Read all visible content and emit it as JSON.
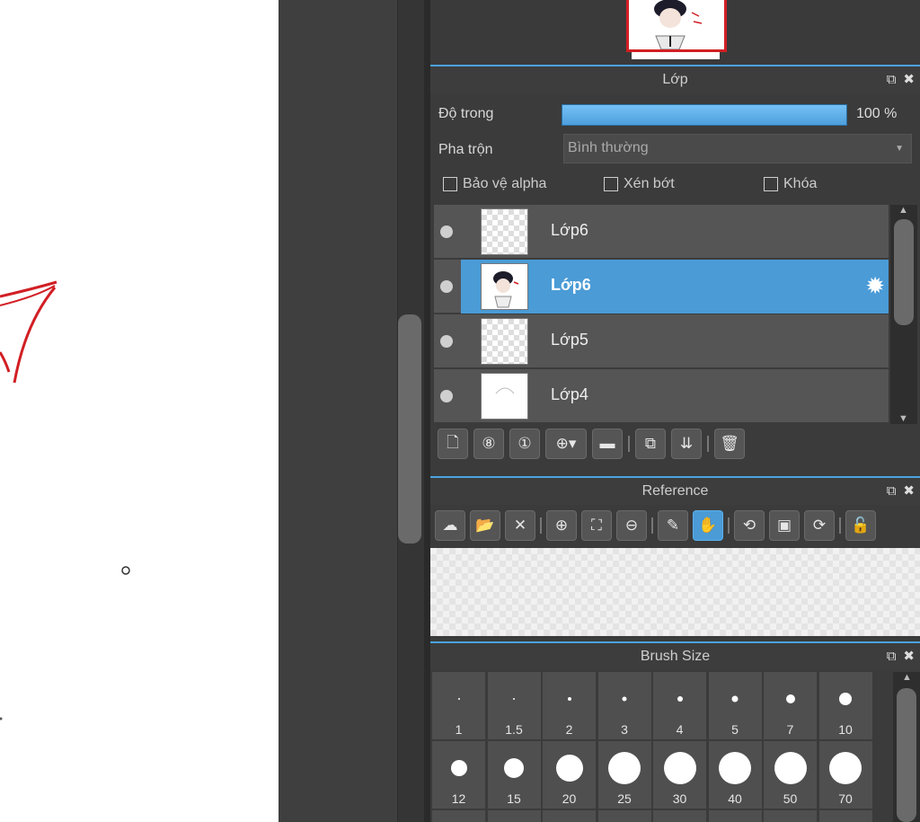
{
  "layer_panel": {
    "title": "Lớp",
    "opacity_label": "Độ trong",
    "opacity_value": "100 %",
    "opacity_fraction": 1.0,
    "blend_label": "Pha trộn",
    "blend_value": "Bình thường",
    "options": {
      "protect_alpha": "Bảo vệ alpha",
      "clipping": "Xén bớt",
      "lock": "Khóa"
    },
    "layers": [
      {
        "name": "Lớp6",
        "selected": false
      },
      {
        "name": "Lớp6",
        "selected": true
      },
      {
        "name": "Lớp5",
        "selected": false
      },
      {
        "name": "Lớp4",
        "selected": false
      }
    ]
  },
  "reference_panel": {
    "title": "Reference"
  },
  "brush_panel": {
    "title": "Brush Size",
    "sizes": [
      "1",
      "1.5",
      "2",
      "3",
      "4",
      "5",
      "7",
      "10",
      "12",
      "15",
      "20",
      "25",
      "30",
      "40",
      "50",
      "70"
    ]
  },
  "colors": {
    "accent": "#4a9bd6",
    "panel_bg": "#3b3b3b",
    "stroke_red": "#d11f24"
  }
}
